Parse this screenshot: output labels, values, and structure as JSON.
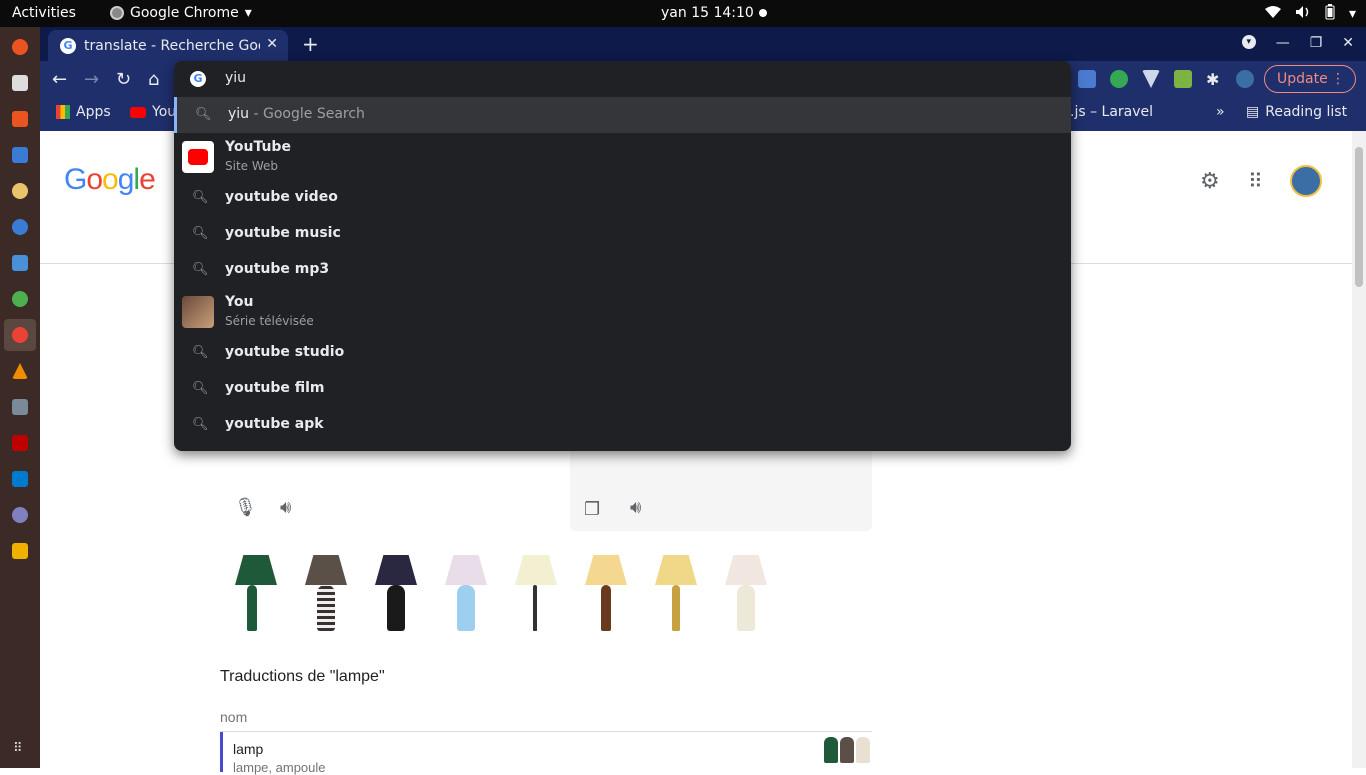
{
  "gnome": {
    "activities": "Activities",
    "app_name": "Google Chrome",
    "app_arrow": "▾",
    "clock": "yan 15  14:10"
  },
  "chrome": {
    "tab_title": "translate - Recherche Goo",
    "tab_close": "✕",
    "new_tab": "+",
    "back": "←",
    "forward": "→",
    "reload": "↻",
    "home": "⌂",
    "update_label": "Update",
    "menu_dots": "⋮",
    "bookmarks": {
      "apps": "Apps",
      "youtube": "You",
      "laravel": ".js – Laravel",
      "more": "»",
      "reading_list": "Reading list"
    }
  },
  "omnibox": {
    "query": "yiu",
    "search_suggestion": {
      "query": "yiu",
      "suffix": " - Google Search"
    },
    "youtube": {
      "title": "YouTube",
      "subtitle": "Site Web"
    },
    "s1": "youtube video",
    "s2": "youtube music",
    "s3": "youtube mp3",
    "you": {
      "title": "You",
      "subtitle": "Série télévisée"
    },
    "s4": "youtube studio",
    "s5": "youtube film",
    "s6": "youtube apk"
  },
  "page": {
    "logo_letters": [
      "G",
      "o",
      "o",
      "g",
      "l",
      "e"
    ],
    "logo_colors": [
      "#4285f4",
      "#ea4335",
      "#fbbc05",
      "#4285f4",
      "#34a853",
      "#ea4335"
    ],
    "translations_title": "Traductions de \"lampe\"",
    "nom": "nom",
    "word": "lamp",
    "synonyms": "lampe, ampoule"
  }
}
